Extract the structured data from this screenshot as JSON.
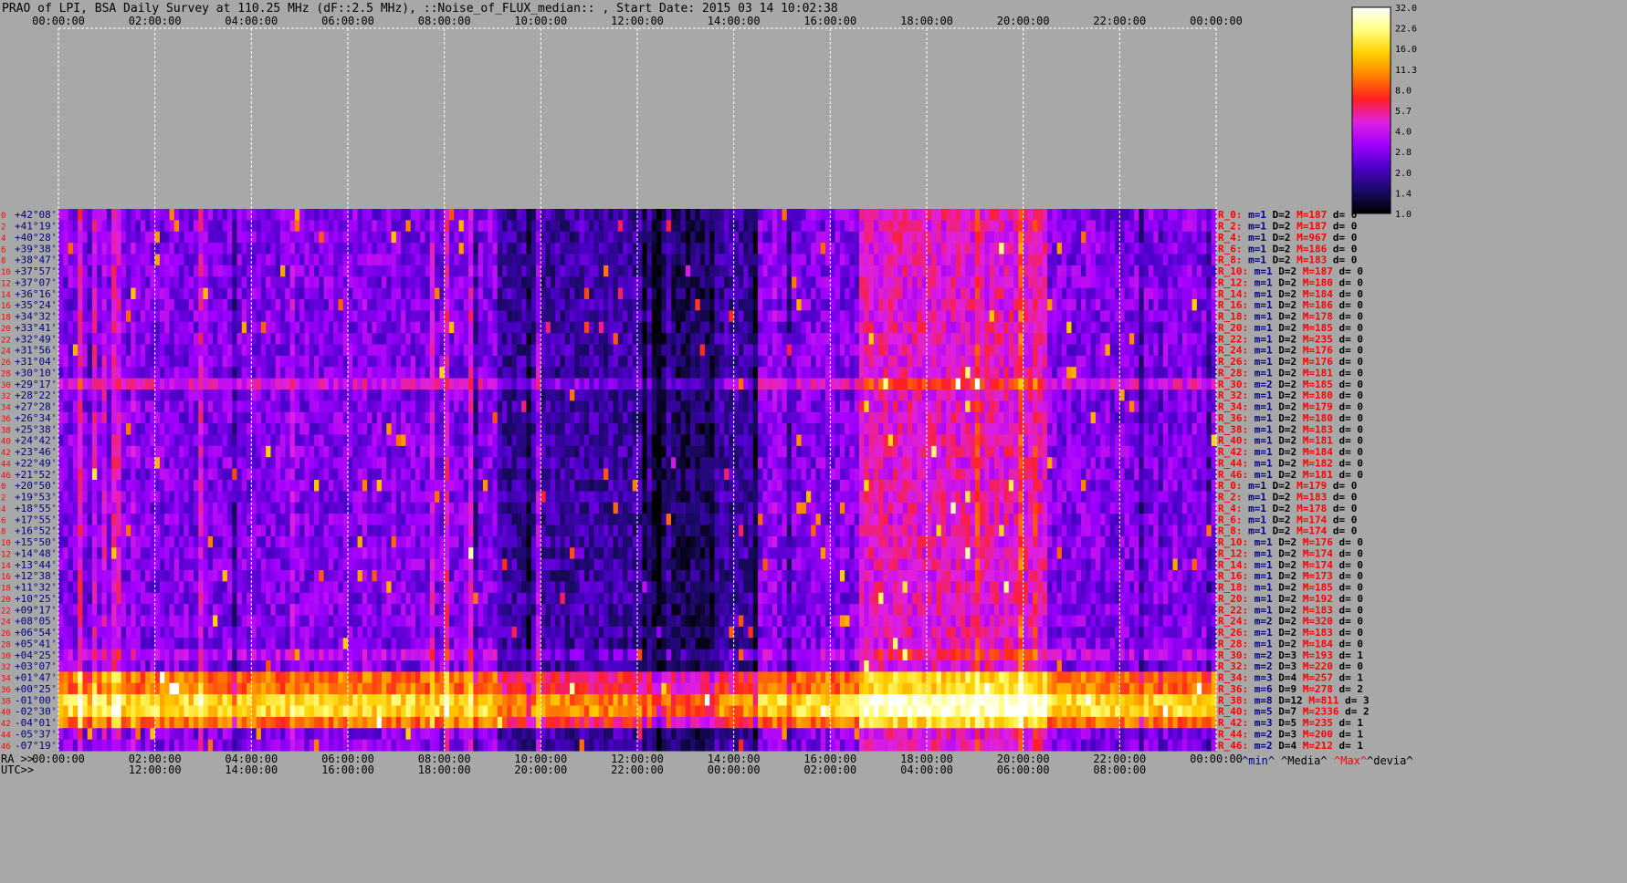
{
  "header": {
    "title": "PRAO of LPI, BSA Daily Survey at 110.25 MHz (dF::2.5 MHz), ::Noise_of_FLUX_median:: , Start Date: 2015 03 14 10:02:38"
  },
  "colors": {
    "background": "#a8a8a8",
    "grid": "#ffffff",
    "ra_label": "#ff0000",
    "dec_label": "#000080"
  },
  "axes": {
    "top_time_ticks": [
      "00:00:00",
      "02:00:00",
      "04:00:00",
      "06:00:00",
      "08:00:00",
      "10:00:00",
      "12:00:00",
      "14:00:00",
      "16:00:00",
      "18:00:00",
      "20:00:00",
      "22:00:00",
      "00:00:00"
    ],
    "bottom_ra_prefix": "RA >>",
    "bottom_ra_ticks": [
      "00:00:00",
      "02:00:00",
      "04:00:00",
      "06:00:00",
      "08:00:00",
      "10:00:00",
      "12:00:00",
      "14:00:00",
      "16:00:00",
      "18:00:00",
      "20:00:00",
      "22:00:00",
      "00:00:00"
    ],
    "bottom_utc_prefix": "UTC>>",
    "bottom_utc_ticks": [
      "12:00:00",
      "14:00:00",
      "16:00:00",
      "18:00:00",
      "20:00:00",
      "22:00:00",
      "00:00:00",
      "02:00:00",
      "04:00:00",
      "06:00:00",
      "08:00:00"
    ]
  },
  "beams": {
    "indices": [
      "0",
      "2",
      "4",
      "6",
      "8",
      "10",
      "12",
      "14",
      "16",
      "18",
      "20",
      "22",
      "24",
      "26",
      "28",
      "30",
      "32",
      "34",
      "36",
      "38",
      "40",
      "42",
      "44",
      "46",
      "0",
      "2",
      "4",
      "6",
      "8",
      "10",
      "12",
      "14",
      "16",
      "18",
      "20",
      "22",
      "24",
      "26",
      "28",
      "30",
      "32",
      "34",
      "36",
      "38",
      "40",
      "42",
      "44",
      "46"
    ],
    "declinations": [
      "+42°08'",
      "+41°19'",
      "+40°28'",
      "+39°38'",
      "+38°47'",
      "+37°57'",
      "+37°07'",
      "+36°16'",
      "+35°24'",
      "+34°32'",
      "+33°41'",
      "+32°49'",
      "+31°56'",
      "+31°04'",
      "+30°10'",
      "+29°17'",
      "+28°22'",
      "+27°28'",
      "+26°34'",
      "+25°38'",
      "+24°42'",
      "+23°46'",
      "+22°49'",
      "+21°52'",
      "+20°50'",
      "+19°53'",
      "+18°55'",
      "+17°55'",
      "+16°52'",
      "+15°50'",
      "+14°48'",
      "+13°44'",
      "+12°38'",
      "+11°32'",
      "+10°25'",
      "+09°17'",
      "+08°05'",
      "+06°54'",
      "+05°41'",
      "+04°25'",
      "+03°07'",
      "+01°47'",
      "+00°25'",
      "-01°00'",
      "-02°30'",
      "-04°01'",
      "-05°37'",
      "-07°19'"
    ]
  },
  "stats": {
    "rows": [
      {
        "r": "R_0:",
        "min": "1",
        "D": "2",
        "M": "187",
        "d": "0"
      },
      {
        "r": "R_2:",
        "min": "1",
        "D": "2",
        "M": "187",
        "d": "0"
      },
      {
        "r": "R_4:",
        "min": "1",
        "D": "2",
        "M": "967",
        "d": "0"
      },
      {
        "r": "R_6:",
        "min": "1",
        "D": "2",
        "M": "186",
        "d": "0"
      },
      {
        "r": "R_8:",
        "min": "1",
        "D": "2",
        "M": "183",
        "d": "0"
      },
      {
        "r": "R_10:",
        "min": "1",
        "D": "2",
        "M": "187",
        "d": "0"
      },
      {
        "r": "R_12:",
        "min": "1",
        "D": "2",
        "M": "180",
        "d": "0"
      },
      {
        "r": "R_14:",
        "min": "1",
        "D": "2",
        "M": "184",
        "d": "0"
      },
      {
        "r": "R_16:",
        "min": "1",
        "D": "2",
        "M": "186",
        "d": "0"
      },
      {
        "r": "R_18:",
        "min": "1",
        "D": "2",
        "M": "178",
        "d": "0"
      },
      {
        "r": "R_20:",
        "min": "1",
        "D": "2",
        "M": "185",
        "d": "0"
      },
      {
        "r": "R_22:",
        "min": "1",
        "D": "2",
        "M": "235",
        "d": "0"
      },
      {
        "r": "R_24:",
        "min": "1",
        "D": "2",
        "M": "176",
        "d": "0"
      },
      {
        "r": "R_26:",
        "min": "1",
        "D": "2",
        "M": "176",
        "d": "0"
      },
      {
        "r": "R_28:",
        "min": "1",
        "D": "2",
        "M": "181",
        "d": "0"
      },
      {
        "r": "R_30:",
        "min": "2",
        "D": "2",
        "M": "185",
        "d": "0"
      },
      {
        "r": "R_32:",
        "min": "1",
        "D": "2",
        "M": "180",
        "d": "0"
      },
      {
        "r": "R_34:",
        "min": "1",
        "D": "2",
        "M": "179",
        "d": "0"
      },
      {
        "r": "R_36:",
        "min": "1",
        "D": "2",
        "M": "180",
        "d": "0"
      },
      {
        "r": "R_38:",
        "min": "1",
        "D": "2",
        "M": "183",
        "d": "0"
      },
      {
        "r": "R_40:",
        "min": "1",
        "D": "2",
        "M": "181",
        "d": "0"
      },
      {
        "r": "R_42:",
        "min": "1",
        "D": "2",
        "M": "184",
        "d": "0"
      },
      {
        "r": "R_44:",
        "min": "1",
        "D": "2",
        "M": "182",
        "d": "0"
      },
      {
        "r": "R_46:",
        "min": "1",
        "D": "2",
        "M": "181",
        "d": "0"
      },
      {
        "r": "R_0:",
        "min": "1",
        "D": "2",
        "M": "179",
        "d": "0"
      },
      {
        "r": "R_2:",
        "min": "1",
        "D": "2",
        "M": "183",
        "d": "0"
      },
      {
        "r": "R_4:",
        "min": "1",
        "D": "2",
        "M": "178",
        "d": "0"
      },
      {
        "r": "R_6:",
        "min": "1",
        "D": "2",
        "M": "174",
        "d": "0"
      },
      {
        "r": "R_8:",
        "min": "1",
        "D": "2",
        "M": "174",
        "d": "0"
      },
      {
        "r": "R_10:",
        "min": "1",
        "D": "2",
        "M": "176",
        "d": "0"
      },
      {
        "r": "R_12:",
        "min": "1",
        "D": "2",
        "M": "174",
        "d": "0"
      },
      {
        "r": "R_14:",
        "min": "1",
        "D": "2",
        "M": "174",
        "d": "0"
      },
      {
        "r": "R_16:",
        "min": "1",
        "D": "2",
        "M": "173",
        "d": "0"
      },
      {
        "r": "R_18:",
        "min": "1",
        "D": "2",
        "M": "185",
        "d": "0"
      },
      {
        "r": "R_20:",
        "min": "1",
        "D": "2",
        "M": "192",
        "d": "0"
      },
      {
        "r": "R_22:",
        "min": "1",
        "D": "2",
        "M": "183",
        "d": "0"
      },
      {
        "r": "R_24:",
        "min": "2",
        "D": "2",
        "M": "320",
        "d": "0"
      },
      {
        "r": "R_26:",
        "min": "1",
        "D": "2",
        "M": "183",
        "d": "0"
      },
      {
        "r": "R_28:",
        "min": "1",
        "D": "2",
        "M": "184",
        "d": "0"
      },
      {
        "r": "R_30:",
        "min": "2",
        "D": "3",
        "M": "193",
        "d": "1"
      },
      {
        "r": "R_32:",
        "min": "2",
        "D": "3",
        "M": "220",
        "d": "0"
      },
      {
        "r": "R_34:",
        "min": "3",
        "D": "4",
        "M": "257",
        "d": "1"
      },
      {
        "r": "R_36:",
        "min": "6",
        "D": "9",
        "M": "278",
        "d": "2"
      },
      {
        "r": "R_38:",
        "min": "8",
        "D": "12",
        "M": "811",
        "d": "3"
      },
      {
        "r": "R_40:",
        "min": "5",
        "D": "7",
        "M": "2336",
        "d": "2"
      },
      {
        "r": "R_42:",
        "min": "3",
        "D": "5",
        "M": "235",
        "d": "1"
      },
      {
        "r": "R_44:",
        "min": "2",
        "D": "3",
        "M": "200",
        "d": "1"
      },
      {
        "r": "R_46:",
        "min": "2",
        "D": "4",
        "M": "212",
        "d": "1"
      }
    ],
    "footer": {
      "min": "^min^",
      "media": "^Media^",
      "max": "^Max^",
      "devia": "^devia^"
    }
  },
  "colorbar": {
    "ticks": [
      "32.0",
      "22.6",
      "16.0",
      "11.3",
      "8.0",
      "5.7",
      "4.0",
      "2.8",
      "2.0",
      "1.4",
      "1.0"
    ],
    "stops": [
      "#000000",
      "#1a0a66",
      "#4b00c8",
      "#a000ff",
      "#e020e0",
      "#ff2020",
      "#ff8000",
      "#ffd000",
      "#ffff80",
      "#ffffff"
    ]
  },
  "chart_data": {
    "type": "heatmap",
    "title": "PRAO of LPI, BSA Daily Survey at 110.25 MHz (dF::2.5 MHz), ::Noise_of_FLUX_median:: , Start Date: 2015 03 14 10:02:38",
    "x_axis": "RA / UTC (hours), 24 h span",
    "y_axis": "48 beams, declination +42°08' to -07°19'",
    "colorbar_range": [
      1.0,
      32.0
    ],
    "colorbar_scale": "log",
    "grid": true,
    "bright_bands_declination": [
      "+01°47'",
      "+00°25'",
      "-01°00'",
      "-02°30'",
      "-04°01'"
    ]
  }
}
